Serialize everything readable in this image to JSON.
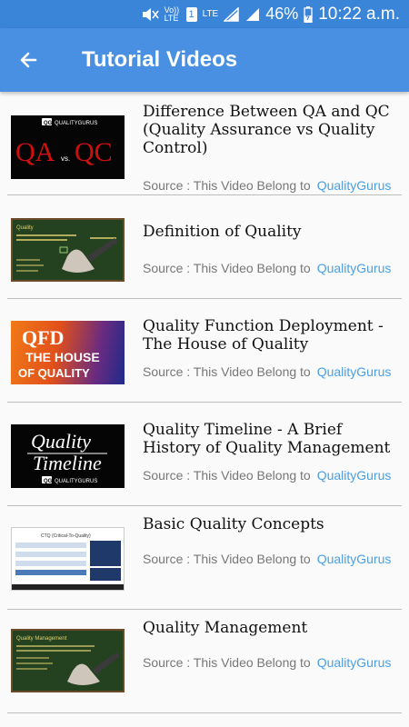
{
  "statusbar": {
    "volte": "Vo)) LTE",
    "sim": "1",
    "lte": "LTE",
    "battery_pct": "46%",
    "time": "10:22 a.m."
  },
  "appbar": {
    "title": "Tutorial Videos"
  },
  "videos": [
    {
      "title": "Difference Between QA and QC (Quality Assurance vs Quality Control)",
      "source_label": "Source : This Video Belong to",
      "source_link": "QualityGurus",
      "thumb": {
        "brand": "QUALITYGURUS",
        "left": "QA",
        "mid": "vs.",
        "right": "QC"
      }
    },
    {
      "title": "Definition of Quality",
      "source_label": "Source : This Video Belong to",
      "source_link": "QualityGurus",
      "thumb": {
        "heading": "Quality"
      }
    },
    {
      "title": "Quality Function Deployment - The House of Quality",
      "source_label": "Source : This Video Belong to",
      "source_link": "QualityGurus",
      "thumb": {
        "line1": "QFD",
        "line2": "THE HOUSE",
        "line3": "OF QUALITY"
      }
    },
    {
      "title": "Quality Timeline - A Brief History of Quality Management",
      "source_label": "Source : This Video Belong to",
      "source_link": "QualityGurus",
      "thumb": {
        "line1": "Quality",
        "line2": "Timeline",
        "brand": "QUALITYGURUS"
      }
    },
    {
      "title": "Basic Quality Concepts",
      "source_label": "Source : This Video Belong to",
      "source_link": "QualityGurus",
      "thumb": {
        "heading": "CTQ (Critical-To-Quality)"
      }
    },
    {
      "title": "Quality Management",
      "source_label": "Source : This Video Belong to",
      "source_link": "QualityGurus",
      "thumb": {
        "heading": "Quality Management"
      }
    }
  ],
  "colors": {
    "statusbar": "#3b85d8",
    "appbar": "#4a90e2",
    "link": "#4a9fe0"
  }
}
